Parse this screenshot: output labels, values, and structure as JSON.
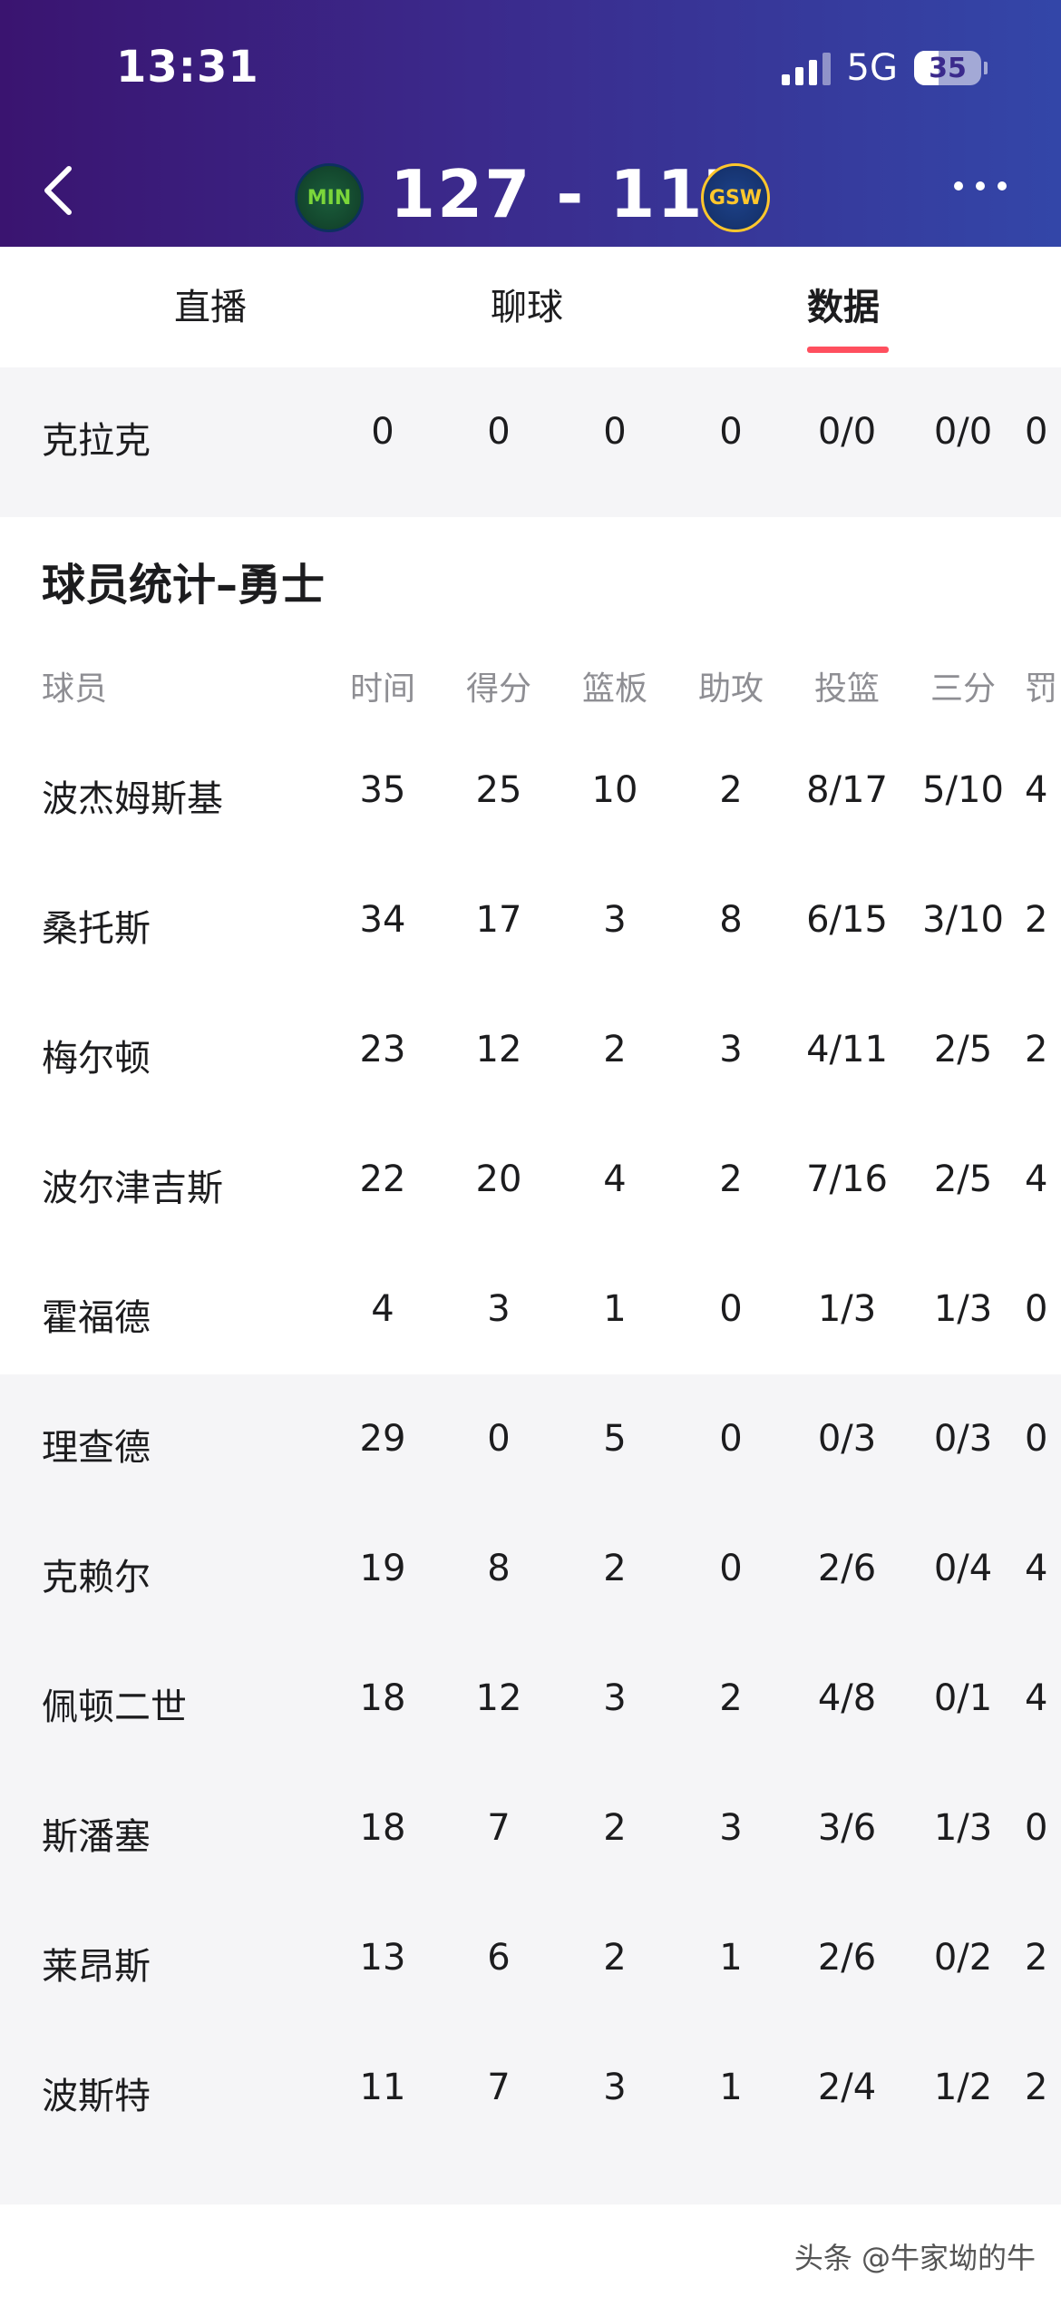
{
  "status": {
    "time": "13:31",
    "network": "5G",
    "battery": "35"
  },
  "game": {
    "home_logo": "MIN",
    "away_logo": "GSW",
    "score": "127 - 117"
  },
  "tabs": [
    "直播",
    "聊球",
    "数据"
  ],
  "prev_row": {
    "name": "克拉克",
    "stats": [
      "0",
      "0",
      "0",
      "0",
      "0/0",
      "0/0",
      "0"
    ]
  },
  "section_title": "球员统计–勇士",
  "columns": [
    "球员",
    "时间",
    "得分",
    "篮板",
    "助攻",
    "投篮",
    "三分",
    "罚"
  ],
  "starters": [
    {
      "name": "波杰姆斯基",
      "stats": [
        "35",
        "25",
        "10",
        "2",
        "8/17",
        "5/10",
        "4"
      ]
    },
    {
      "name": "桑托斯",
      "stats": [
        "34",
        "17",
        "3",
        "8",
        "6/15",
        "3/10",
        "2"
      ]
    },
    {
      "name": "梅尔顿",
      "stats": [
        "23",
        "12",
        "2",
        "3",
        "4/11",
        "2/5",
        "2"
      ]
    },
    {
      "name": "波尔津吉斯",
      "stats": [
        "22",
        "20",
        "4",
        "2",
        "7/16",
        "2/5",
        "4"
      ]
    },
    {
      "name": "霍福德",
      "stats": [
        "4",
        "3",
        "1",
        "0",
        "1/3",
        "1/3",
        "0"
      ]
    }
  ],
  "bench": [
    {
      "name": "理查德",
      "stats": [
        "29",
        "0",
        "5",
        "0",
        "0/3",
        "0/3",
        "0"
      ]
    },
    {
      "name": "克赖尔",
      "stats": [
        "19",
        "8",
        "2",
        "0",
        "2/6",
        "0/4",
        "4"
      ]
    },
    {
      "name": "佩顿二世",
      "stats": [
        "18",
        "12",
        "3",
        "2",
        "4/8",
        "0/1",
        "4"
      ]
    },
    {
      "name": "斯潘塞",
      "stats": [
        "18",
        "7",
        "2",
        "3",
        "3/6",
        "1/3",
        "0"
      ]
    },
    {
      "name": "莱昂斯",
      "stats": [
        "13",
        "6",
        "2",
        "1",
        "2/6",
        "0/2",
        "2"
      ]
    },
    {
      "name": "波斯特",
      "stats": [
        "11",
        "7",
        "3",
        "1",
        "2/4",
        "1/2",
        "2"
      ]
    }
  ],
  "watermark": "头条 @牛家坳的牛"
}
